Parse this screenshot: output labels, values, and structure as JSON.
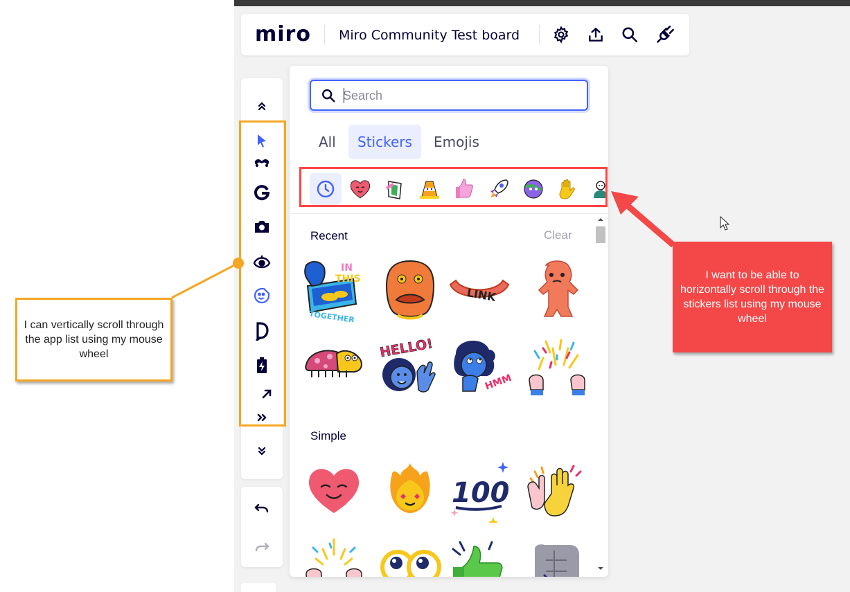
{
  "board": {
    "logo": "miro",
    "title": "Miro Community Test board",
    "icons": [
      "gear-icon",
      "upload-icon",
      "search-icon",
      "plugin-icon"
    ]
  },
  "toolbar": {
    "icons": [
      "chevron-up-double-icon",
      "cursor-icon",
      "mustache-icon",
      "google-icon",
      "camera-icon",
      "eye-app-icon",
      "sticker-face-icon",
      "d-app-icon",
      "battery-charge-icon",
      "arrow-up-right-icon",
      "chevron-right-double-icon",
      "chevron-down-double-icon"
    ],
    "undo_icon": "undo-icon",
    "redo_icon": "redo-icon"
  },
  "panel": {
    "search_placeholder": "Search",
    "tabs": [
      {
        "label": "All",
        "active": false
      },
      {
        "label": "Stickers",
        "active": true
      },
      {
        "label": "Emojis",
        "active": false
      }
    ],
    "categories": [
      "clock-icon",
      "heart-sticker",
      "flag-sticker",
      "cone-sticker",
      "thumbs-sticker",
      "rocket-sticker",
      "planet-sticker",
      "hand-sticker",
      "people-sticker"
    ],
    "recent": {
      "title": "Recent",
      "clear_label": "Clear",
      "stickers": [
        "in-this-together-sticker",
        "orange-monster-face-sticker",
        "link-sausage-sticker",
        "orange-monster-sticker",
        "snail-bug-sticker",
        "hello-sticker",
        "hmm-sticker",
        "celebrate-hands-sticker"
      ]
    },
    "simple": {
      "title": "Simple",
      "stickers": [
        "smiling-heart-sticker",
        "fire-face-sticker",
        "hundred-sticker",
        "wave-hands-sticker",
        "confetti-hands-sticker",
        "big-eyes-sticker",
        "thumbs-up-sticker",
        "fist-sticker"
      ]
    }
  },
  "annotations": {
    "left_note": "I can vertically scroll through the app list using my mouse wheel",
    "right_note": "I want to be able to horizontally scroll through the stickers list using my mouse wheel",
    "accent_yellow": "#f5a623",
    "accent_red": "#f44748"
  },
  "colors": {
    "brand_blue": "#4262ff",
    "text_dark": "#050038",
    "canvas_bg": "#f2f2f2"
  }
}
